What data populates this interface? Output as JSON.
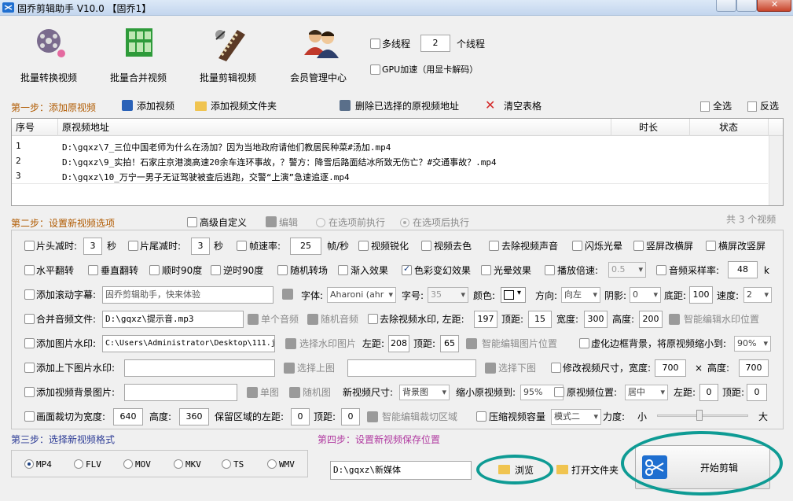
{
  "window": {
    "title": "固乔剪辑助手 V10.0 【固乔1】"
  },
  "toolbar": {
    "batch_convert": "批量转换视频",
    "batch_merge": "批量合并视频",
    "batch_cut": "批量剪辑视频",
    "member_center": "会员管理中心",
    "multithread_label": "多线程",
    "thread_count": "2",
    "thread_unit": "个线程",
    "gpu_label": "GPU加速（用显卡解码）"
  },
  "step1": {
    "title": "第一步：添加原视频",
    "add_video": "添加视频",
    "add_folder": "添加视频文件夹",
    "delete_selected": "删除已选择的原视频地址",
    "clear_table": "清空表格",
    "select_all": "全选",
    "invert_select": "反选"
  },
  "table": {
    "headers": [
      "序号",
      "原视频地址",
      "时长",
      "状态"
    ],
    "rows": [
      {
        "no": "1",
        "path": "D:\\gqxz\\7_三位中国老师为什么在汤加？因为当地政府请他们教居民种菜#汤加.mp4",
        "duration": "",
        "status": ""
      },
      {
        "no": "2",
        "path": "D:\\gqxz\\9_实拍！石家庄京港澳高速20余车连环事故，？警方：降雪后路面结冰所致无伤亡？#交通事故？.mp4",
        "duration": "",
        "status": ""
      },
      {
        "no": "3",
        "path": "D:\\gqxz\\10_万宁一男子无证驾驶被查后逃跑，交警“上演”急速追逐.mp4",
        "duration": "",
        "status": ""
      }
    ]
  },
  "step2": {
    "title": "第二步：设置新视频选项",
    "advanced": "高级自定义",
    "edit": "编辑",
    "before_opt": "在选项前执行",
    "after_opt": "在选项后执行",
    "count_text": "共 3 个视频"
  },
  "opts": {
    "head_cut": "片头减时:",
    "head_val": "3",
    "sec1": "秒",
    "tail_cut": "片尾减时:",
    "tail_val": "3",
    "sec2": "秒",
    "framerate": "帧速率:",
    "fr_val": "25",
    "fr_unit": "帧/秒",
    "sharpen": "视频锐化",
    "decolor": "视频去色",
    "remove_audio": "去除视频声音",
    "flash": "闪烁光晕",
    "v2h": "竖屏改横屏",
    "h2v": "横屏改竖屏",
    "hflip": "水平翻转",
    "vflip": "垂直翻转",
    "cw90": "顺时90度",
    "ccw90": "逆时90度",
    "rand_trans": "随机转场",
    "fade_in": "渐入效果",
    "color_fx": "色彩变幻效果",
    "halo": "光晕效果",
    "speed": "播放倍速:",
    "speed_val": "0.5",
    "sample_rate": "音频采样率:",
    "sr_val": "48",
    "sr_unit": "k",
    "scroll_sub": "添加滚动字幕:",
    "sub_text": "固乔剪辑助手，快来体验",
    "font": "字体:",
    "font_val": "Aharoni (ahr",
    "font_size": "字号:",
    "fs_val": "35",
    "color": "颜色:",
    "direction": "方向:",
    "dir_val": "向左",
    "shadow": "阴影:",
    "shadow_val": "0",
    "bottom": "底距:",
    "bottom_val": "100",
    "spd": "速度:",
    "spd_val": "2",
    "merge_audio": "合并音频文件:",
    "audio_path": "D:\\gqxz\\提示音.mp3",
    "single_audio": "单个音频",
    "rand_audio": "随机音频",
    "remove_wm": "去除视频水印, 左距:",
    "wm_left": "197",
    "top": "顶距:",
    "wm_top": "15",
    "width": "宽度:",
    "wm_w": "300",
    "height": "高度:",
    "wm_h": "200",
    "smart_wm": "智能编辑水印位置",
    "img_wm": "添加图片水印:",
    "img_path": "C:\\Users\\Administrator\\Desktop\\111.j",
    "choose_wm": "选择水印图片",
    "left": "左距:",
    "iw_left": "208",
    "top2": "顶距:",
    "iw_top": "65",
    "smart_img": "智能编辑图片位置",
    "blur_bg": "虚化边框背景，将原视频缩小到:",
    "blur_val": "90%",
    "tb_wm": "添加上下图片水印:",
    "choose_top": "选择上图",
    "choose_bottom": "选择下图",
    "resize": "修改视频尺寸，宽度:",
    "rs_w": "700",
    "times": "×",
    "height2": "高度:",
    "rs_h": "700",
    "bg_img": "添加视频背景图片:",
    "single_img": "单图",
    "rand_img": "随机图",
    "new_size": "新视频尺寸:",
    "new_size_val": "背景图",
    "shrink": "缩小原视频到:",
    "shrink_val": "95%",
    "orig_pos": "原视频位置:",
    "orig_pos_val": "居中",
    "left3": "左距:",
    "pos_left": "0",
    "top3": "顶距:",
    "pos_top": "0",
    "crop": "画面裁切为宽度:",
    "crop_w": "640",
    "height3": "高度:",
    "crop_h": "360",
    "keep_left": "保留区域的左距:",
    "keep_left_val": "0",
    "top4": "顶距:",
    "keep_top": "0",
    "smart_crop": "智能编辑裁切区域",
    "compress": "压缩视频容量",
    "mode_val": "模式二",
    "strength": "力度:",
    "small": "小",
    "big": "大"
  },
  "step3": {
    "title": "第三步：选择新视频格式",
    "formats": [
      "MP4",
      "FLV",
      "MOV",
      "MKV",
      "TS",
      "WMV"
    ]
  },
  "step4": {
    "title": "第四步：设置新视频保存位置",
    "path": "D:\\gqxz\\新媒体",
    "browse": "浏览",
    "open_folder": "打开文件夹"
  },
  "start": {
    "label": "开始剪辑"
  },
  "colors": {
    "accent": "#0e9b94",
    "title_bg": "#c3d6ee"
  }
}
